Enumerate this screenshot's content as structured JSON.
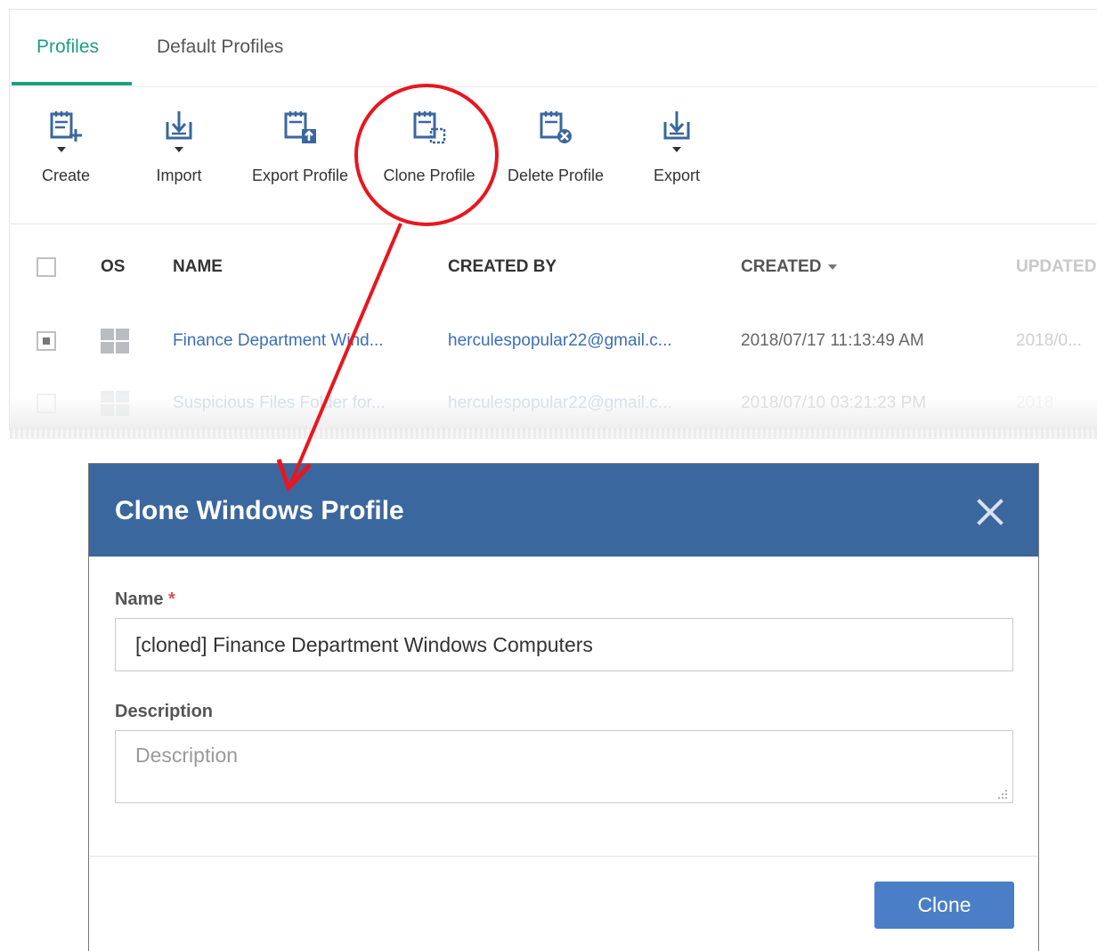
{
  "tabs": [
    {
      "label": "Profiles",
      "active": true
    },
    {
      "label": "Default Profiles",
      "active": false
    }
  ],
  "toolbar": {
    "create": "Create",
    "import": "Import",
    "export_profile": "Export Profile",
    "clone_profile": "Clone Profile",
    "delete_profile": "Delete Profile",
    "export": "Export"
  },
  "table": {
    "headers": {
      "os": "OS",
      "name": "NAME",
      "created_by": "CREATED BY",
      "created": "CREATED",
      "updated": "UPDATED"
    },
    "rows": [
      {
        "checked": true,
        "os_icon": "windows-icon",
        "name": "Finance Department Wind...",
        "created_by": "herculespopular22@gmail.c...",
        "created": "2018/07/17 11:13:49 AM",
        "updated": "2018/0..."
      },
      {
        "checked": false,
        "os_icon": "windows-icon",
        "name": "Suspicious Files Folder for...",
        "created_by": "herculespopular22@gmail.c...",
        "created": "2018/07/10 03:21:23 PM",
        "updated": "2018"
      }
    ]
  },
  "modal": {
    "title": "Clone Windows Profile",
    "name_label": "Name",
    "required_mark": "*",
    "name_value": "[cloned] Finance Department Windows Computers",
    "description_label": "Description",
    "description_placeholder": "Description",
    "clone_button": "Clone"
  },
  "colors": {
    "accent": "#1e9e84",
    "link": "#3b6fb6",
    "modal_header": "#3a679d",
    "button": "#4a7fc7",
    "annotation": "#e8161f"
  }
}
